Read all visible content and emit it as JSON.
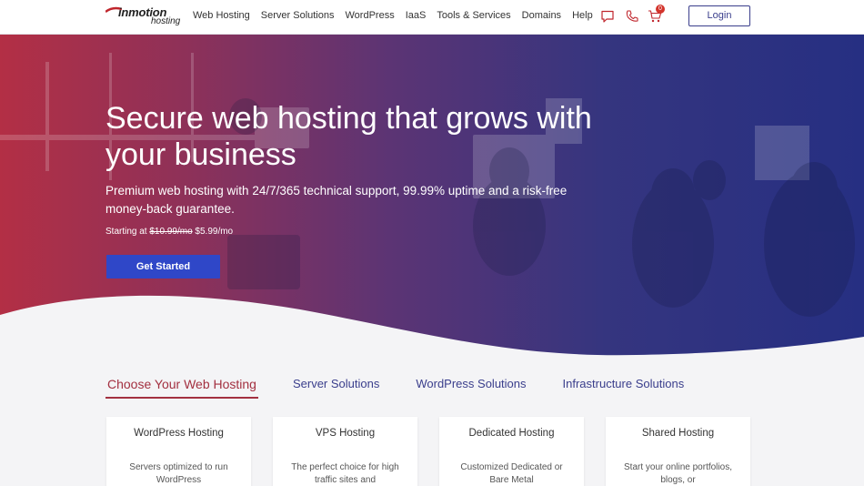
{
  "header": {
    "logo_main": "inmotion",
    "logo_sub": "hosting",
    "nav": [
      "Web Hosting",
      "Server Solutions",
      "WordPress",
      "IaaS",
      "Tools & Services",
      "Domains",
      "Help"
    ],
    "icons": [
      "chat-icon",
      "phone-icon",
      "cart-icon"
    ],
    "cart_count": "0",
    "login_label": "Login"
  },
  "hero": {
    "title": "Secure web hosting that grows with your business",
    "subtitle": "Premium web hosting with 24/7/365 technical support, 99.99% uptime and a risk-free money-back guarantee.",
    "price_prefix": "Starting at",
    "price_old": "$10.99/mo",
    "price_new": "$5.99/mo",
    "cta_label": "Get Started"
  },
  "tabs": [
    {
      "label": "Choose Your Web Hosting",
      "active": true
    },
    {
      "label": "Server Solutions",
      "active": false
    },
    {
      "label": "WordPress Solutions",
      "active": false
    },
    {
      "label": "Infrastructure Solutions",
      "active": false
    }
  ],
  "cards": [
    {
      "title": "WordPress Hosting",
      "desc": "Servers optimized to run WordPress"
    },
    {
      "title": "VPS Hosting",
      "desc": "The perfect choice for high traffic sites and"
    },
    {
      "title": "Dedicated Hosting",
      "desc": "Customized Dedicated or Bare Metal"
    },
    {
      "title": "Shared Hosting",
      "desc": "Start your online portfolios, blogs, or"
    }
  ],
  "colors": {
    "brand_navy": "#3a3e8c",
    "brand_red": "#a33040",
    "cta_blue": "#2f47c8",
    "badge_red": "#d3342c"
  }
}
